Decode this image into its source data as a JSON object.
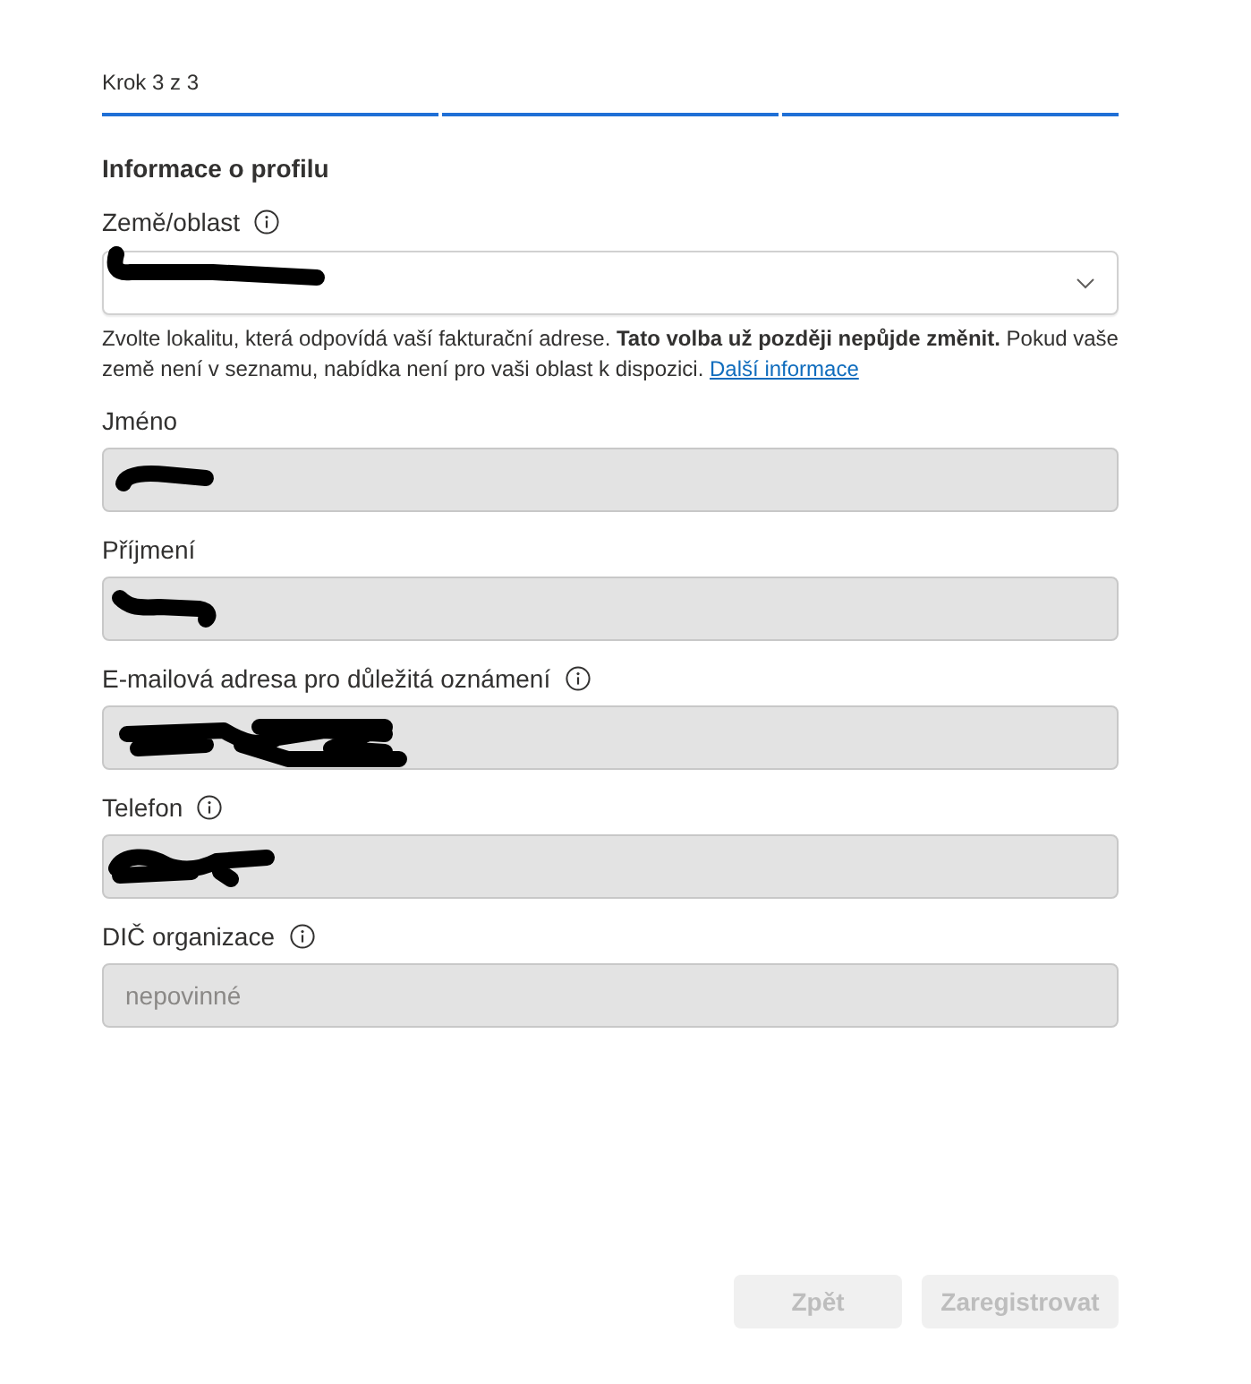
{
  "progress": {
    "label": "Krok 3 z 3",
    "segments": [
      {
        "done": true
      },
      {
        "done": true
      },
      {
        "done": true
      }
    ]
  },
  "section": {
    "title": "Informace o profilu"
  },
  "fields": [
    {
      "kind": "select",
      "label": "Země/oblast",
      "info": true,
      "disabled": false,
      "redacted": true,
      "help": {
        "text": "Zvolte lokalitu, která odpovídá vaší fakturační adrese. **Tato volba už později nepůjde změnit.** Pokud vaše země není v seznamu, nabídka není pro vaši oblast k dispozici.",
        "link": "Další informace"
      }
    },
    {
      "kind": "text",
      "label": "Jméno",
      "info": false,
      "disabled": true,
      "redacted": true
    },
    {
      "kind": "text",
      "label": "Příjmení",
      "info": false,
      "disabled": true,
      "redacted": true
    },
    {
      "kind": "text",
      "label": "E-mailová adresa pro důležitá oznámení",
      "info": true,
      "disabled": true,
      "redacted": true
    },
    {
      "kind": "text",
      "label": "Telefon",
      "info": true,
      "disabled": true,
      "redacted": true
    },
    {
      "kind": "text",
      "label": "DIČ organizace",
      "info": true,
      "disabled": true,
      "redacted": false,
      "placeholder": "nepovinné"
    }
  ],
  "buttons": [
    {
      "label": "Zpět",
      "disabled": true
    },
    {
      "label": "Zaregistrovat",
      "disabled": true
    }
  ]
}
